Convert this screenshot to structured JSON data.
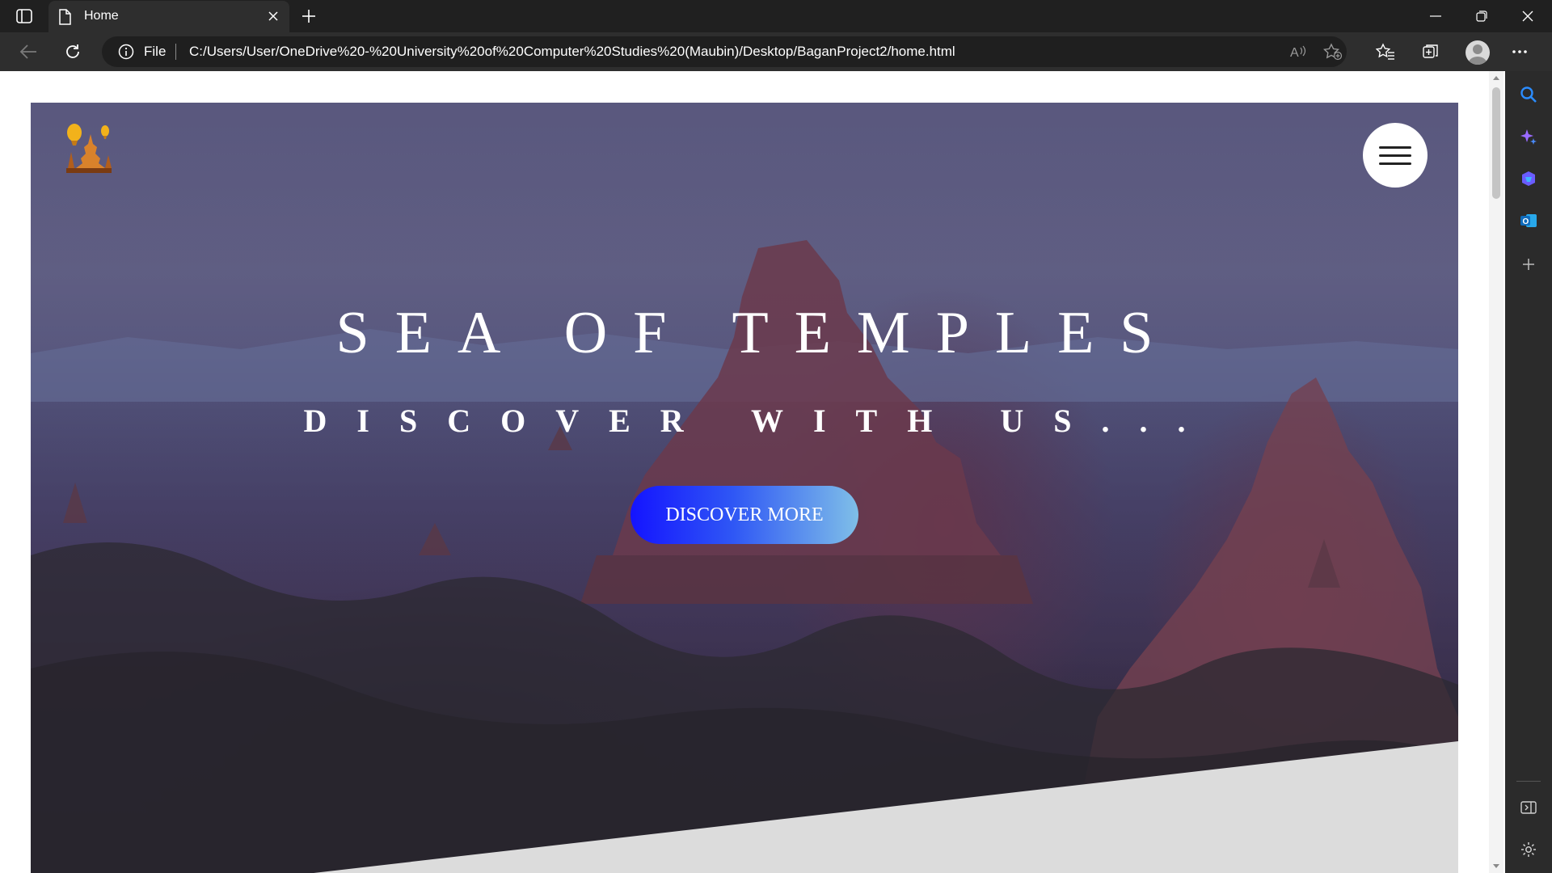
{
  "browser": {
    "tab_title": "Home",
    "address_prefix": "File",
    "url": "C:/Users/User/OneDrive%20-%20University%20of%20Computer%20Studies%20(Maubin)/Desktop/BaganProject2/home.html",
    "icons": [
      "tab-actions-icon",
      "page-icon",
      "close-icon",
      "plus-icon",
      "minimize-icon",
      "restore-icon",
      "close-window-icon",
      "back-icon",
      "refresh-icon",
      "info-icon",
      "read-aloud-icon",
      "add-favorite-icon",
      "favorites-icon",
      "collections-icon",
      "profile-icon",
      "more-icon"
    ]
  },
  "sidebar": {
    "icons": [
      "search-icon",
      "copilot-icon",
      "shopping-icon",
      "outlook-icon",
      "add-icon",
      "hide-sidebar-icon",
      "settings-icon"
    ]
  },
  "page": {
    "hero": {
      "title": "SEA OF TEMPLES",
      "subtitle": "DISCOVER WITH US...",
      "cta_label": "DISCOVER MORE"
    },
    "colors": {
      "cta_start": "#1414ff",
      "cta_end": "#7fbfe8",
      "slant_section": "#dcdcdc",
      "hero_overlay": "#4a3f66"
    }
  }
}
